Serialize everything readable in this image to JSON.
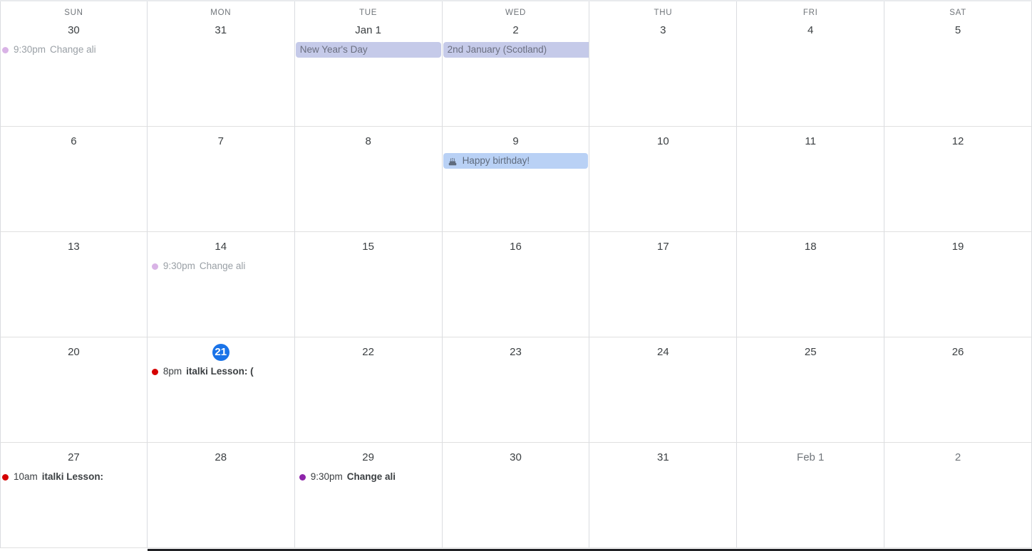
{
  "view": {
    "type": "month",
    "weekday_headers": [
      "SUN",
      "MON",
      "TUE",
      "WED",
      "THU",
      "FRI",
      "SAT"
    ],
    "today_label": "21"
  },
  "colors": {
    "today_badge": "#1a73e8",
    "holiday_chip": "#c5cae9",
    "birthday_chip": "#b9d1f5",
    "event_red": "#d50000",
    "event_purple": "#8e24aa",
    "event_purple_faded": "#d9b3e6",
    "grid_line": "#dadce0",
    "text_primary": "#3c4043",
    "text_muted": "#70757a",
    "scrollbar": "#202124"
  },
  "weeks": [
    {
      "days": [
        {
          "dow": "SUN",
          "number": "30",
          "other_month": false,
          "today": false,
          "events": [
            {
              "kind": "timed",
              "time": "9:30pm",
              "title": "Change ali",
              "dot_color": "#d9b3e6",
              "past": true,
              "flush": true
            }
          ]
        },
        {
          "dow": "MON",
          "number": "31",
          "other_month": false,
          "today": false,
          "events": []
        },
        {
          "dow": "TUE",
          "number": "Jan 1",
          "other_month": false,
          "today": false,
          "events": [
            {
              "kind": "chip",
              "style": "holiday",
              "title": "New Year's Day",
              "icon": null,
              "overflow": false
            }
          ]
        },
        {
          "dow": "WED",
          "number": "2",
          "other_month": false,
          "today": false,
          "events": [
            {
              "kind": "chip",
              "style": "holiday",
              "title": "2nd January (Scotland)",
              "icon": null,
              "overflow": true
            }
          ]
        },
        {
          "dow": "THU",
          "number": "3",
          "other_month": false,
          "today": false,
          "events": []
        },
        {
          "dow": "FRI",
          "number": "4",
          "other_month": false,
          "today": false,
          "events": []
        },
        {
          "dow": "SAT",
          "number": "5",
          "other_month": false,
          "today": false,
          "events": []
        }
      ]
    },
    {
      "days": [
        {
          "dow": null,
          "number": "6",
          "other_month": false,
          "today": false,
          "events": []
        },
        {
          "dow": null,
          "number": "7",
          "other_month": false,
          "today": false,
          "events": []
        },
        {
          "dow": null,
          "number": "8",
          "other_month": false,
          "today": false,
          "events": []
        },
        {
          "dow": null,
          "number": "9",
          "other_month": false,
          "today": false,
          "events": [
            {
              "kind": "chip",
              "style": "birthday",
              "title": "Happy birthday!",
              "icon": "birthday-cake-icon",
              "overflow": false
            }
          ]
        },
        {
          "dow": null,
          "number": "10",
          "other_month": false,
          "today": false,
          "events": []
        },
        {
          "dow": null,
          "number": "11",
          "other_month": false,
          "today": false,
          "events": []
        },
        {
          "dow": null,
          "number": "12",
          "other_month": false,
          "today": false,
          "events": []
        }
      ]
    },
    {
      "days": [
        {
          "dow": null,
          "number": "13",
          "other_month": false,
          "today": false,
          "events": []
        },
        {
          "dow": null,
          "number": "14",
          "other_month": false,
          "today": false,
          "events": [
            {
              "kind": "timed",
              "time": "9:30pm",
              "title": "Change ali",
              "dot_color": "#d9b3e6",
              "past": true,
              "flush": false
            }
          ]
        },
        {
          "dow": null,
          "number": "15",
          "other_month": false,
          "today": false,
          "events": []
        },
        {
          "dow": null,
          "number": "16",
          "other_month": false,
          "today": false,
          "events": []
        },
        {
          "dow": null,
          "number": "17",
          "other_month": false,
          "today": false,
          "events": []
        },
        {
          "dow": null,
          "number": "18",
          "other_month": false,
          "today": false,
          "events": []
        },
        {
          "dow": null,
          "number": "19",
          "other_month": false,
          "today": false,
          "events": []
        }
      ]
    },
    {
      "days": [
        {
          "dow": null,
          "number": "20",
          "other_month": false,
          "today": false,
          "events": []
        },
        {
          "dow": null,
          "number": "21",
          "other_month": false,
          "today": true,
          "events": [
            {
              "kind": "timed",
              "time": "8pm",
              "title": "italki Lesson: (",
              "dot_color": "#d50000",
              "past": false,
              "flush": false
            }
          ]
        },
        {
          "dow": null,
          "number": "22",
          "other_month": false,
          "today": false,
          "events": []
        },
        {
          "dow": null,
          "number": "23",
          "other_month": false,
          "today": false,
          "events": []
        },
        {
          "dow": null,
          "number": "24",
          "other_month": false,
          "today": false,
          "events": []
        },
        {
          "dow": null,
          "number": "25",
          "other_month": false,
          "today": false,
          "events": []
        },
        {
          "dow": null,
          "number": "26",
          "other_month": false,
          "today": false,
          "events": []
        }
      ]
    },
    {
      "days": [
        {
          "dow": null,
          "number": "27",
          "other_month": false,
          "today": false,
          "events": [
            {
              "kind": "timed",
              "time": "10am",
              "title": "italki Lesson:",
              "dot_color": "#d50000",
              "past": false,
              "flush": true
            }
          ]
        },
        {
          "dow": null,
          "number": "28",
          "other_month": false,
          "today": false,
          "events": []
        },
        {
          "dow": null,
          "number": "29",
          "other_month": false,
          "today": false,
          "events": [
            {
              "kind": "timed",
              "time": "9:30pm",
              "title": "Change ali",
              "dot_color": "#8e24aa",
              "past": false,
              "flush": false
            }
          ]
        },
        {
          "dow": null,
          "number": "30",
          "other_month": false,
          "today": false,
          "events": []
        },
        {
          "dow": null,
          "number": "31",
          "other_month": false,
          "today": false,
          "events": []
        },
        {
          "dow": null,
          "number": "Feb 1",
          "other_month": true,
          "today": false,
          "events": []
        },
        {
          "dow": null,
          "number": "2",
          "other_month": true,
          "today": false,
          "events": []
        }
      ]
    }
  ]
}
